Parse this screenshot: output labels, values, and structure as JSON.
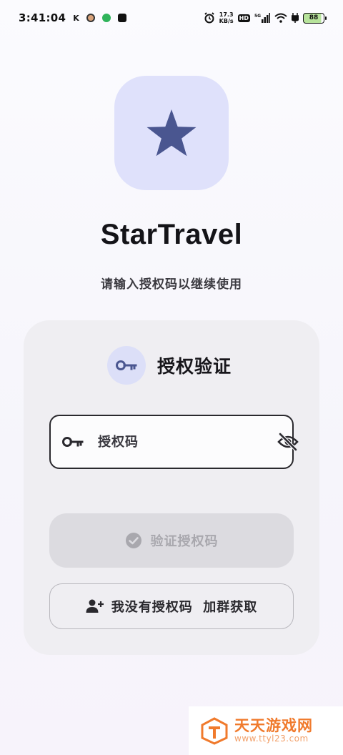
{
  "status_bar": {
    "time": "3:41:04",
    "notification_letter": "K",
    "net_speed_value": "17.3",
    "net_speed_unit": "KB/s",
    "hd_label": "HD",
    "network_type": "5G",
    "battery_level": "88",
    "icons": [
      "alarm-icon",
      "hd-icon",
      "signal-icon",
      "wifi-icon",
      "charging-icon",
      "battery-icon"
    ]
  },
  "app": {
    "title": "StarTravel",
    "subtitle": "请输入授权码以继续使用",
    "logo_icon": "star-icon",
    "accent_color": "#4a5690",
    "logo_bg_color": "#dfe1fb"
  },
  "auth_card": {
    "title": "授权验证",
    "title_icon": "key-icon",
    "code_input": {
      "placeholder": "授权码",
      "value": "",
      "leading_icon": "key-icon",
      "trailing_icon": "eye-off-icon"
    },
    "verify_button": {
      "label": "验证授权码",
      "icon": "check-circle-icon",
      "enabled": false
    },
    "no_code_button": {
      "label": "我没有授权码  加群获取",
      "icon": "add-person-icon"
    }
  },
  "watermark": {
    "text": "天天游戏网",
    "url": "www.ttyl23.com"
  }
}
